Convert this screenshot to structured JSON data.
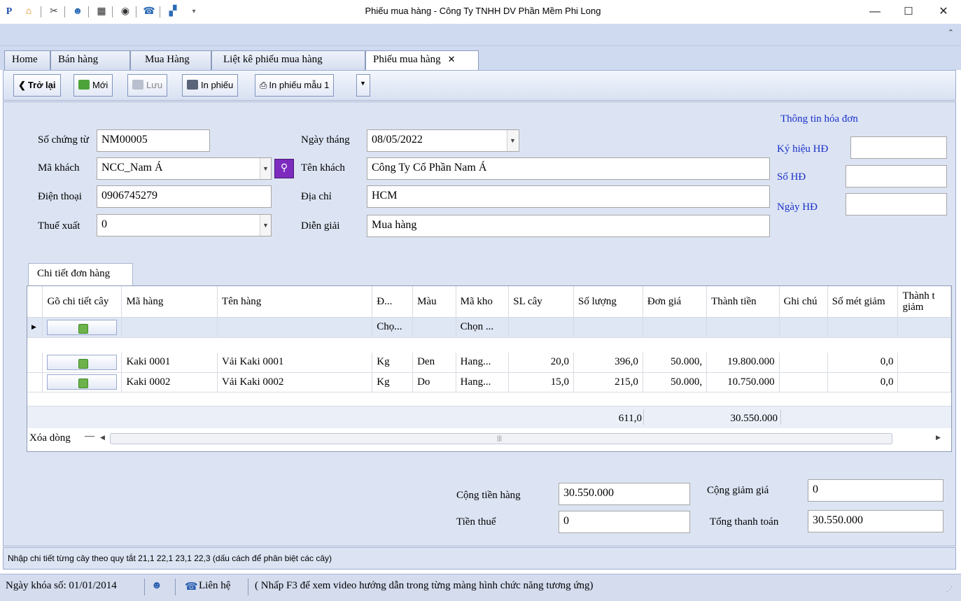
{
  "window": {
    "title": "Phiếu mua hàng - Công Ty TNHH DV Phần Mềm Phi Long",
    "minimize": "—",
    "maximize": "☐",
    "close": "✕"
  },
  "quick_access": [
    "logo-icon",
    "home-icon",
    "tools-icon",
    "users-icon",
    "video-icon",
    "eye-icon",
    "phone-icon",
    "window-icon",
    "customize-icon"
  ],
  "tabs": [
    {
      "label": "Home"
    },
    {
      "label": "Bán hàng"
    },
    {
      "label": "Mua Hàng"
    },
    {
      "label": "Liệt kê phiếu mua hàng"
    },
    {
      "label": "Phiếu mua hàng",
      "active": true
    }
  ],
  "toolbar": {
    "back": "Trở lại",
    "new": "Mới",
    "save": "Lưu",
    "print": "In phiếu",
    "print_template": "In phiếu mẫu 1"
  },
  "form": {
    "so_chung_tu": {
      "label": "Số chứng từ",
      "value": "NM00005"
    },
    "ma_khach": {
      "label": "Mã khách",
      "value": "NCC_Nam Á"
    },
    "dien_thoai": {
      "label": "Điện thoại",
      "value": "0906745279"
    },
    "thue_xuat": {
      "label": "Thuế xuất",
      "value": "0"
    },
    "ngay_thang": {
      "label": "Ngày tháng",
      "value": "08/05/2022"
    },
    "ten_khach": {
      "label": "Tên khách",
      "value": "Công Ty Cổ Phần Nam Á"
    },
    "dia_chi": {
      "label": "Địa chỉ",
      "value": "HCM"
    },
    "dien_giai": {
      "label": "Diễn giải",
      "value": "Mua hàng"
    }
  },
  "invoice": {
    "title": "Thông tin hóa đơn",
    "ky_hieu": {
      "label": "Ký hiệu HĐ",
      "value": ""
    },
    "so_hd": {
      "label": "Số HĐ",
      "value": ""
    },
    "ngay_hd": {
      "label": "Ngày HĐ",
      "value": ""
    }
  },
  "grid": {
    "tab_label": "Chi tiết đơn hàng",
    "columns": [
      "Gõ chi tiết cây",
      "Mã hàng",
      "Tên hàng",
      "Đ...",
      "Màu",
      "Mã kho",
      "SL cây",
      "Số lượng",
      "Đơn giá",
      "Thành tiền",
      "Ghi chú",
      "Số mét giảm",
      "Thành t giảm"
    ],
    "filter_row": {
      "dvt": "Chọ...",
      "kho": "Chọn ..."
    },
    "rows": [
      {
        "ma_hang": "Kaki 0001",
        "ten_hang": "Vải Kaki 0001",
        "dvt": "Kg",
        "mau": "Den",
        "kho": "Hang...",
        "sl_cay": "20,0",
        "so_luong": "396,0",
        "don_gia": "50.000,",
        "thanh_tien": "19.800.000",
        "ghi_chu": "",
        "so_met_giam": "0,0"
      },
      {
        "ma_hang": "Kaki 0002",
        "ten_hang": "Vải Kaki 0002",
        "dvt": "Kg",
        "mau": "Do",
        "kho": "Hang...",
        "sl_cay": "15,0",
        "so_luong": "215,0",
        "don_gia": "50.000,",
        "thanh_tien": "10.750.000",
        "ghi_chu": "",
        "so_met_giam": "0,0"
      }
    ],
    "totals": {
      "so_luong": "611,0",
      "thanh_tien": "30.550.000"
    },
    "delete_row": "Xóa dòng",
    "delete_row_sym": "—",
    "scroll_left": "◀",
    "scroll_right": "▶",
    "scroll_grip": "|||"
  },
  "summary": {
    "cong_tien_hang": {
      "label": "Cộng tiền hàng",
      "value": "30.550.000"
    },
    "tien_thue": {
      "label": "Tiền thuế",
      "value": "0"
    },
    "cong_giam_gia": {
      "label": "Cộng giảm giá",
      "value": "0"
    },
    "tong_thanh_toan": {
      "label": "Tổng thanh toán",
      "value": "30.550.000"
    }
  },
  "hint": "Nhập chi tiết từng cây theo quy tắt  21,1 22,1 23,1 22,3 (dấu cách để phân biệt các cây)",
  "status": {
    "lock_date": "Ngày khóa số: 01/01/2014",
    "contact": "Liên hệ",
    "help": "( Nhấp F3 để xem video hướng dẫn trong từng màng hình chức năng tương ứng)"
  },
  "colors": {
    "accent_blue": "#1a2fc8",
    "panel": "#dce4f3",
    "ribbon": "#cfdaf0"
  }
}
